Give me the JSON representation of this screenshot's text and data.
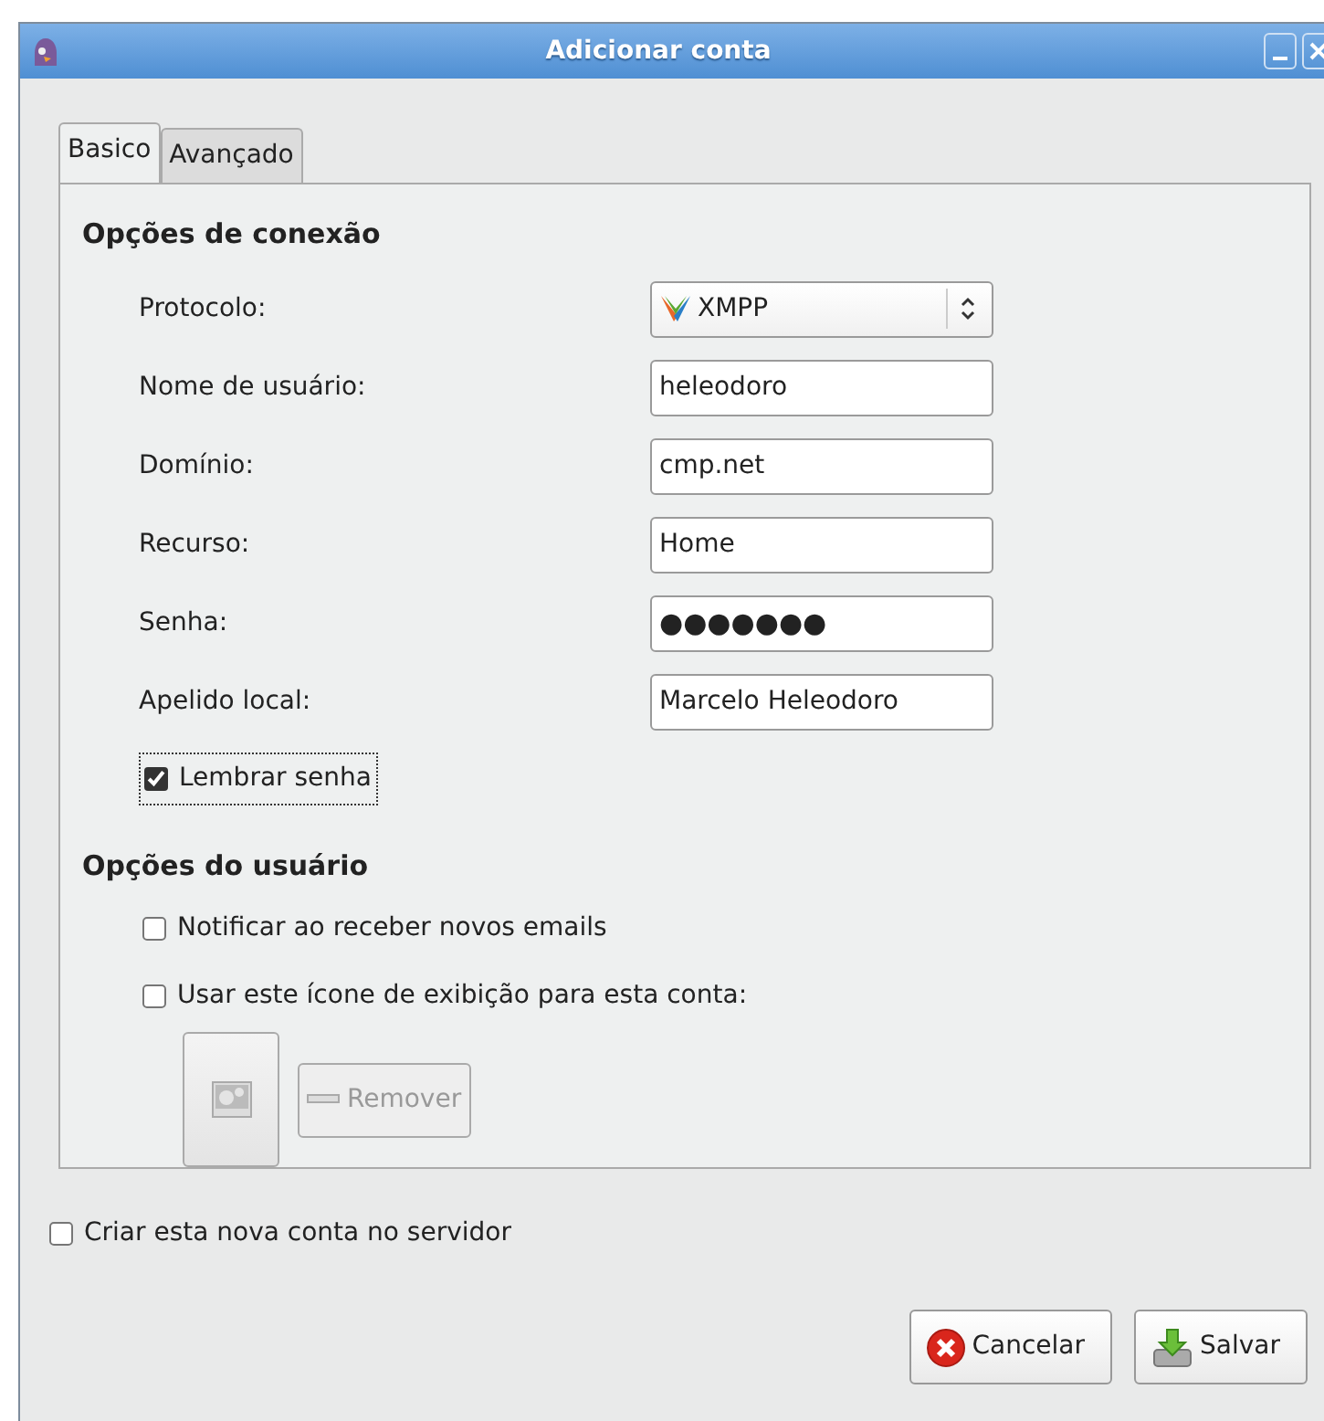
{
  "window": {
    "title": "Adicionar conta"
  },
  "tabs": [
    {
      "label": "Basico",
      "selected": true
    },
    {
      "label": "Avançado",
      "selected": false
    }
  ],
  "sections": [
    {
      "title": "Opções de conexão",
      "fields": [
        {
          "kind": "select",
          "label": "Protocolo:",
          "value": "XMPP"
        },
        {
          "kind": "text",
          "label": "Nome de usuário:",
          "value": "heleodoro"
        },
        {
          "kind": "text",
          "label": "Domínio:",
          "value": "cmp.net"
        },
        {
          "kind": "text",
          "label": "Recurso:",
          "value": "Home"
        },
        {
          "kind": "password",
          "label": "Senha:",
          "value": "●●●●●●●"
        },
        {
          "kind": "text",
          "label": "Apelido local:",
          "value": "Marcelo Heleodoro"
        }
      ],
      "options": [
        {
          "label": "Lembrar senha",
          "checked": true,
          "focused": true
        }
      ]
    },
    {
      "title": "Opções do usuário",
      "options": [
        {
          "label": "Notificar ao receber novos emails",
          "checked": false,
          "focused": false
        },
        {
          "label": "Usar este ícone de exibição para esta conta:",
          "checked": false,
          "focused": false
        }
      ],
      "icon_picker": {
        "remove_button": {
          "label": "Remover",
          "disabled": true
        }
      }
    }
  ],
  "create_on_server": {
    "label": "Criar esta nova conta no servidor",
    "checked": false
  },
  "buttons": [
    {
      "kind": "cancel",
      "label": "Cancelar"
    },
    {
      "kind": "save",
      "label": "Salvar"
    }
  ]
}
